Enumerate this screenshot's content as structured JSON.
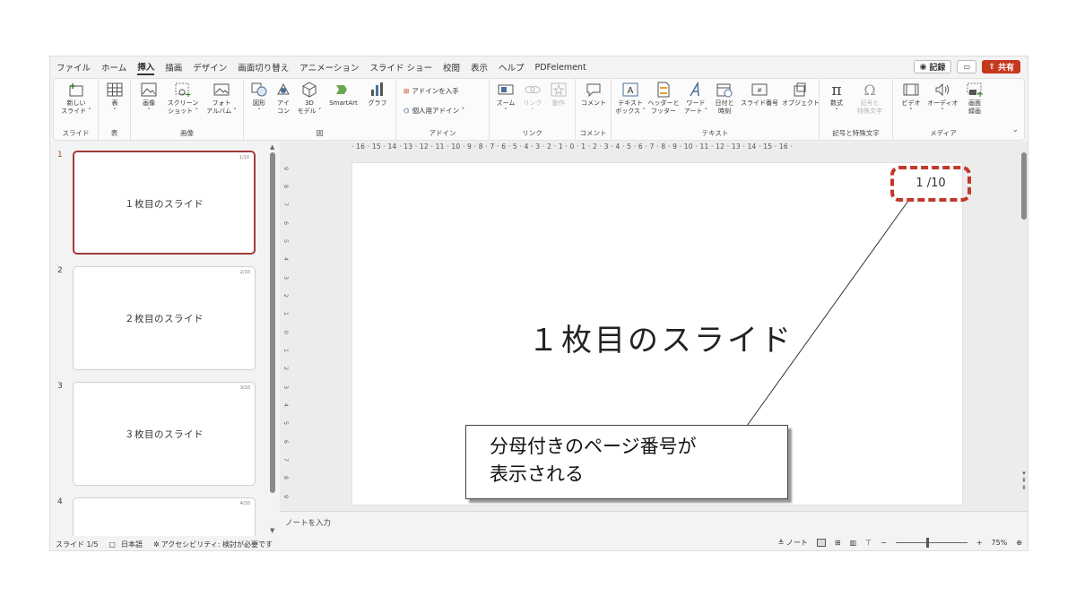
{
  "menu": {
    "tabs": [
      "ファイル",
      "ホーム",
      "挿入",
      "描画",
      "デザイン",
      "画面切り替え",
      "アニメーション",
      "スライド ショー",
      "校閲",
      "表示",
      "ヘルプ",
      "PDFelement"
    ],
    "active_tab": "挿入",
    "record_label": "記録",
    "share_label": "共有"
  },
  "ribbon": {
    "slides": {
      "new_slide": "新しい\nスライド ˅",
      "group": "スライド"
    },
    "table": {
      "table": "表\n˅",
      "group": "表"
    },
    "images": {
      "picture": "画像\n˅",
      "screenshot": "スクリーン\nショット ˅",
      "photo_album": "フォト\nアルバム ˅",
      "group": "画像"
    },
    "illustrations": {
      "shapes": "図形\n˅",
      "icons": "アイ\nコン",
      "model3d": "3D\nモデル ˅",
      "smartart": "SmartArt",
      "chart": "グラフ",
      "group": "図"
    },
    "addins": {
      "get_addins": "アドインを入手",
      "my_addins": "個人用アドイン ˅",
      "group": "アドイン"
    },
    "links": {
      "zoom": "ズーム\n˅",
      "link": "リンク\n˅",
      "action": "動作",
      "group": "リンク"
    },
    "comments": {
      "comment": "コメント",
      "group": "コメント"
    },
    "text": {
      "textbox": "テキスト\nボックス ˅",
      "header_footer": "ヘッダーと\nフッター",
      "wordart": "ワード\nアート ˅",
      "datetime": "日付と\n時刻",
      "slide_number": "スライド番号",
      "object": "オブジェクト",
      "group": "テキスト"
    },
    "symbols": {
      "equation": "数式\n˅",
      "symbol": "記号と\n特殊文字",
      "group": "記号と特殊文字"
    },
    "media": {
      "video": "ビデオ\n˅",
      "audio": "オーディオ\n˅",
      "screen_recording": "画面\n録画",
      "group": "メディア"
    }
  },
  "thumbnails": [
    {
      "num": "1",
      "text": "１枚目のスライド",
      "page": "1/10"
    },
    {
      "num": "2",
      "text": "２枚目のスライド",
      "page": "2/10"
    },
    {
      "num": "3",
      "text": "３枚目のスライド",
      "page": "3/10"
    },
    {
      "num": "4",
      "text": "",
      "page": "4/10"
    }
  ],
  "ruler": {
    "horizontal": "· 16 · 15 · 14 · 13 · 12 · 11 · 10 · 9 · 8 · 7 · 6 · 5 · 4 · 3 · 2 · 1 · 0 · 1 · 2 · 3 · 4 · 5 · 6 · 7 · 8 · 9 · 10 · 11 · 12 · 13 · 14 · 15 · 16 ·",
    "vertical": [
      "9",
      "8",
      "7",
      "6",
      "5",
      "4",
      "3",
      "2",
      "1",
      "0",
      "1",
      "2",
      "3",
      "4",
      "5",
      "6",
      "7",
      "8",
      "9"
    ]
  },
  "slide": {
    "title": "１枚目のスライド",
    "page_number": "1 /10",
    "callout_line1": "分母付きのページ番号が",
    "callout_line2": "表示される"
  },
  "notes_placeholder": "ノートを入力",
  "status": {
    "slide_info": "スライド 1/5",
    "language": "日本語",
    "accessibility": "アクセシビリティ: 検討が必要です",
    "notes_button": "ノート",
    "zoom": "75%"
  },
  "colors": {
    "accent": "#c4381c",
    "highlight_border": "#c0392b",
    "active_thumb": "#a33b3b"
  }
}
